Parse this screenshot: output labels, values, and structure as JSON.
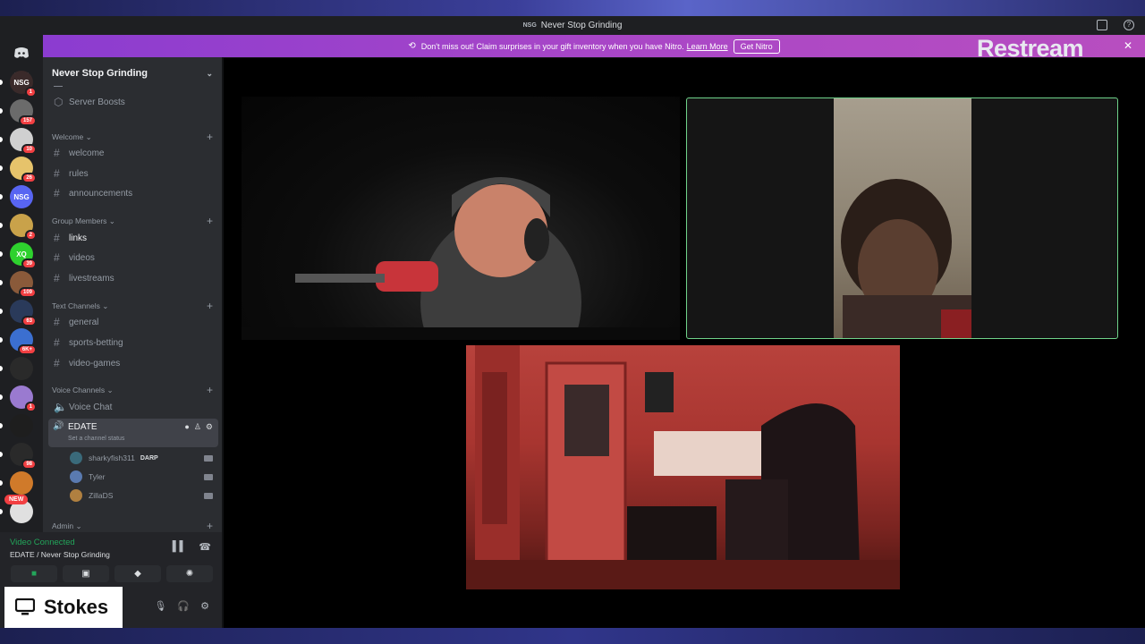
{
  "window": {
    "title": "Never Stop Grinding",
    "server_badge": "NSG"
  },
  "nitro_banner": {
    "text": "Don't miss out! Claim surprises in your gift inventory when you have Nitro.",
    "learn_more": "Learn More",
    "button": "Get Nitro",
    "close": "✕"
  },
  "overlay": {
    "restream": "Restream",
    "streamer_name": "Stokes"
  },
  "server": {
    "name": "Never Stop Grinding",
    "boosts": "Server Boosts"
  },
  "rail": {
    "servers": [
      {
        "label": "NSG",
        "badge": "1",
        "color": "#3a2a2a"
      },
      {
        "label": "",
        "badge": "157",
        "color": "#6b6b6b"
      },
      {
        "label": "",
        "badge": "10",
        "color": "#d0d0d0"
      },
      {
        "label": "",
        "badge": "26",
        "color": "#e6c36b"
      },
      {
        "label": "NSG",
        "badge": "",
        "color": "#5865f2"
      },
      {
        "label": "",
        "badge": "2",
        "color": "#c9a24a"
      },
      {
        "label": "XQ",
        "badge": "39",
        "color": "#2ed12e"
      },
      {
        "label": "",
        "badge": "109",
        "color": "#8a5a3a"
      },
      {
        "label": "",
        "badge": "63",
        "color": "#2a3a5a"
      },
      {
        "label": "",
        "badge": "6K+",
        "color": "#3b6fd0"
      },
      {
        "label": "",
        "badge": "",
        "color": "#2a2a2a"
      },
      {
        "label": "",
        "badge": "1",
        "color": "#9a7ad0"
      },
      {
        "label": "",
        "badge": "",
        "color": "#1e1e1e"
      },
      {
        "label": "",
        "badge": "98",
        "color": "#2a2a2a"
      },
      {
        "label": "",
        "badge": "",
        "color": "#d07a2a"
      },
      {
        "label": "",
        "badge": "",
        "color": "#e0e0e0"
      }
    ],
    "new_badge": "NEW"
  },
  "channels": {
    "welcome_cat": "Welcome",
    "welcome": "welcome",
    "rules": "rules",
    "announcements": "announcements",
    "group_cat": "Group Members",
    "links": "links",
    "videos": "videos",
    "livestreams": "livestreams",
    "text_cat": "Text Channels",
    "general": "general",
    "sports": "sports-betting",
    "games": "video-games",
    "voice_cat": "Voice Channels",
    "voice_chat": "Voice Chat",
    "edate": "EDATE",
    "edate_status": "Set a channel status",
    "admin_cat": "Admin"
  },
  "members": [
    {
      "name": "sharkyfish311",
      "tag": "DARP",
      "color": "#3a6a7a"
    },
    {
      "name": "Tyler",
      "tag": "",
      "color": "#5a7ab0"
    },
    {
      "name": "ZillaDS",
      "tag": "",
      "color": "#b08040"
    }
  ],
  "voice_panel": {
    "status": "Video Connected",
    "channel": "EDATE / Never Stop Grinding"
  }
}
